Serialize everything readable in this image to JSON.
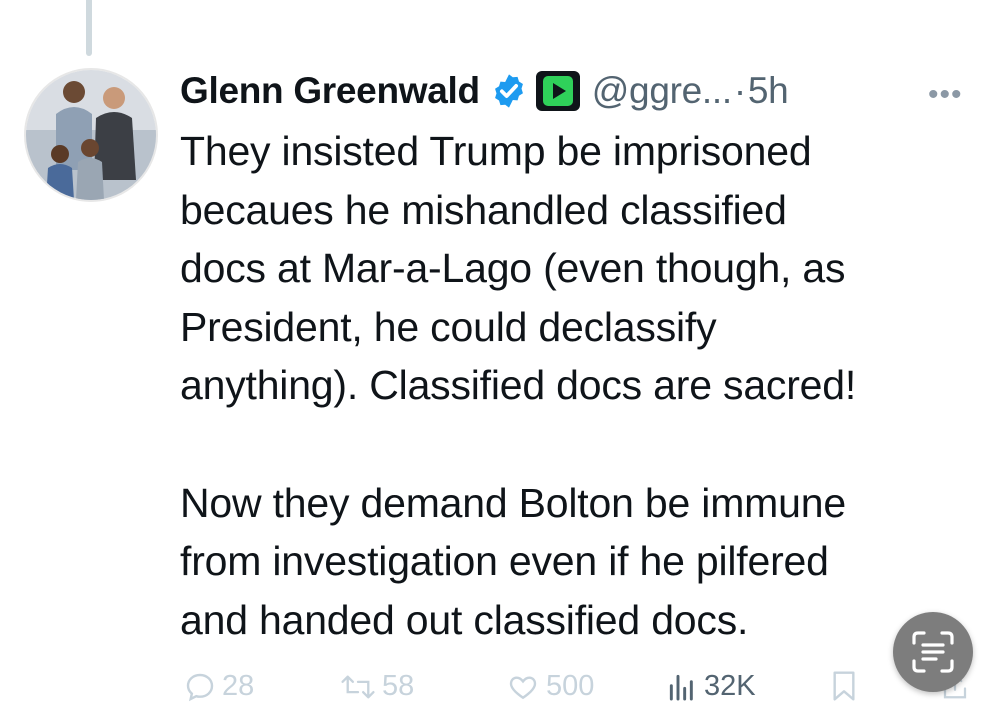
{
  "tweet": {
    "author_name": "Glenn Greenwald",
    "handle": "@ggre...",
    "separator": "·",
    "time": "5h",
    "more_label": "•••",
    "text_lines": [
      "They insisted Trump be imprisoned",
      "becaues he mishandled classified",
      "docs at Mar-a-Lago (even though, as",
      "President, he could declassify",
      "anything). Classified docs are sacred!",
      "",
      "Now they demand Bolton be immune",
      "from investigation even if he pilfered",
      "and handed out classified docs."
    ]
  },
  "actions": {
    "replies": "28",
    "reposts": "58",
    "likes": "500",
    "views": "32K"
  },
  "colors": {
    "text": "#0f1419",
    "muted": "#536471",
    "faded": "#c7d3dc",
    "verified": "#1d9bf0",
    "affiliate_badge": "#2fd15a"
  },
  "icons": [
    "verified-badge-icon",
    "rumble-affiliate-icon",
    "more-icon",
    "reply-icon",
    "repost-icon",
    "like-icon",
    "views-icon",
    "bookmark-icon",
    "share-icon",
    "text-scan-icon"
  ]
}
